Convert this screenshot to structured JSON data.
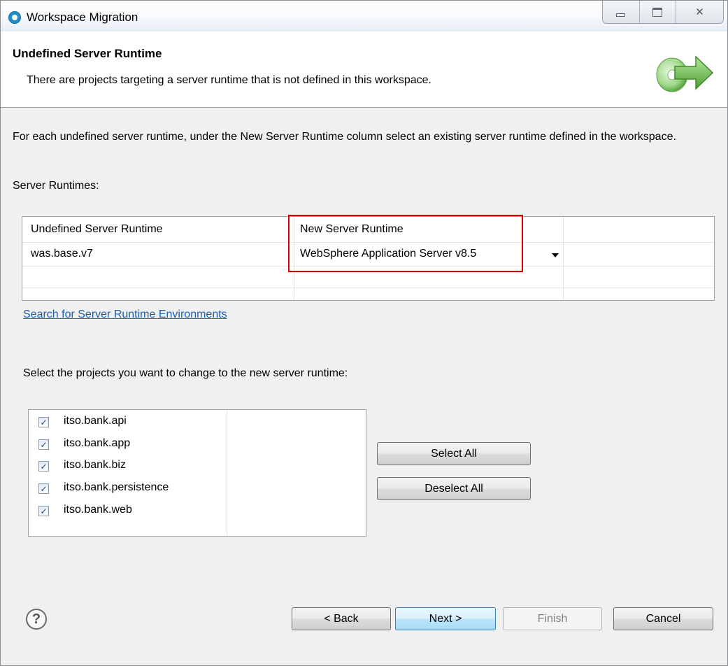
{
  "window": {
    "title": "Workspace Migration"
  },
  "banner": {
    "title": "Undefined Server Runtime",
    "message": "There are projects targeting a server runtime that is not defined in this workspace."
  },
  "instructions": "For each undefined server runtime, under the New Server Runtime column select an existing server runtime defined in the workspace.",
  "runtimes_label": "Server Runtimes:",
  "runtime_table": {
    "headers": [
      "Undefined Server Runtime",
      "New Server Runtime"
    ],
    "rows": [
      {
        "undefined": "was.base.v7",
        "new_runtime": "WebSphere Application Server v8.5"
      }
    ]
  },
  "search_link": "Search for Server Runtime Environments",
  "select_prompt": "Select the projects you want to change to the new server runtime:",
  "projects": [
    {
      "name": "itso.bank.api",
      "checked": true
    },
    {
      "name": "itso.bank.app",
      "checked": true
    },
    {
      "name": "itso.bank.biz",
      "checked": true
    },
    {
      "name": "itso.bank.persistence",
      "checked": true
    },
    {
      "name": "itso.bank.web",
      "checked": true
    }
  ],
  "buttons": {
    "select_all": "Select All",
    "deselect_all": "Deselect All",
    "back": "< Back",
    "next": "Next >",
    "finish": "Finish",
    "cancel": "Cancel"
  },
  "colors": {
    "highlight_border": "#e00000",
    "link": "#1a5fb4",
    "accent_arrow": "#6cc24a"
  },
  "icons": {
    "app": "eclipse-icon",
    "banner": "migration-arrow-icon",
    "help": "help-icon",
    "checkbox": "checkmark-icon",
    "dropdown": "dropdown-arrow-icon"
  }
}
